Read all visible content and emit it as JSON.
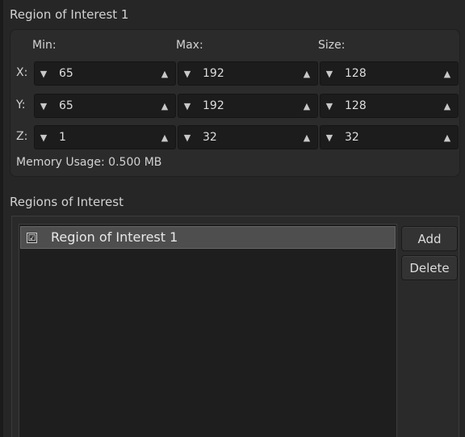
{
  "roi_panel": {
    "title": "Region of Interest 1",
    "col_headers": {
      "min": "Min:",
      "max": "Max:",
      "size": "Size:"
    },
    "rows": [
      {
        "label": "X:",
        "min": "65",
        "max": "192",
        "size": "128"
      },
      {
        "label": "Y:",
        "min": "65",
        "max": "192",
        "size": "128"
      },
      {
        "label": "Z:",
        "min": "1",
        "max": "32",
        "size": "32"
      }
    ],
    "memory_usage": "Memory Usage: 0.500 MB"
  },
  "roi_list": {
    "title": "Regions of Interest",
    "items": [
      {
        "label": "Region of Interest 1",
        "checked": true,
        "check_glyph": "☑"
      }
    ],
    "add_label": "Add",
    "delete_label": "Delete"
  },
  "icons": {
    "decrement": "▼",
    "increment": "▲"
  },
  "colors": {
    "background": "#262626",
    "field_background": "#1c1c1c",
    "selection": "#4e4e4e"
  }
}
